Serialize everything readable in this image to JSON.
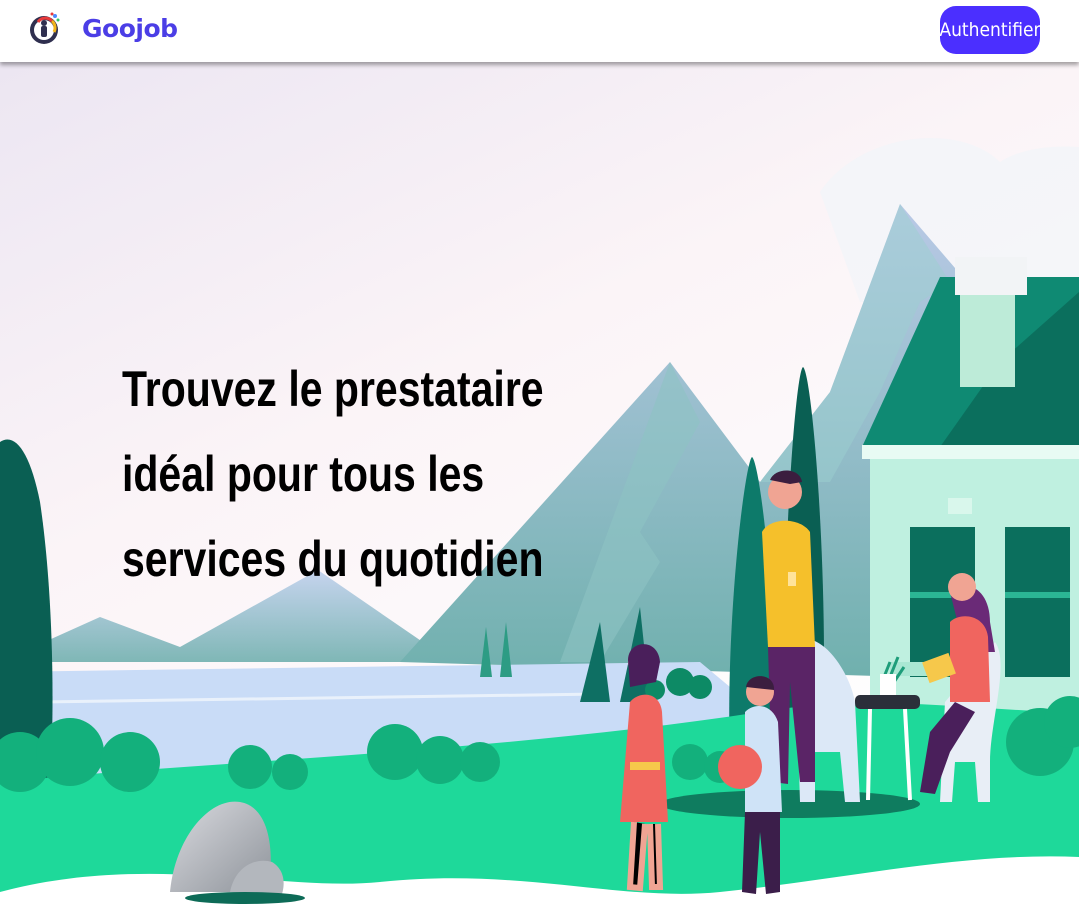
{
  "header": {
    "brand": "Goojob",
    "logo_icon": "goojob-logo-icon",
    "auth_button_label": "Authentifier"
  },
  "hero": {
    "headline": "Trouvez le prestataire idéal pour tous les services du quotidien",
    "illustration": "family-house-mountains-illustration"
  },
  "colors": {
    "brand": "#4b3ee6",
    "button": "#4b2fff",
    "grass": "#1ed99a",
    "house_roof": "#0f8a73"
  }
}
